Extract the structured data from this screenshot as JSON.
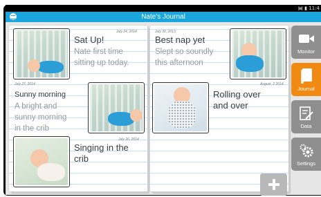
{
  "app": {
    "title": "Nate's Journal",
    "status": {
      "time": "11:4"
    }
  },
  "entries": [
    {
      "date": "July 24, 2014",
      "title": "Sat Up!",
      "text_lines": [
        "Nate first time",
        "sitting up today."
      ]
    },
    {
      "date": "July 27, 2014",
      "title": "Sunny morning",
      "text_lines": [
        "A bright and",
        "sunny morning",
        "in the crib"
      ]
    },
    {
      "date": "July 26, 2014",
      "title_lines": [
        "Singing in the",
        "crib"
      ]
    },
    {
      "date": "July 30, 2013",
      "title": "Best nap yet",
      "text_lines": [
        "Slept so soundly",
        "this afternoon"
      ]
    },
    {
      "date": "August, 2 2014",
      "title_lines": [
        "Rolling over",
        "and over"
      ]
    }
  ],
  "nav": [
    {
      "label": "Monitor",
      "icon": "camera-icon",
      "active": false
    },
    {
      "label": "Journal",
      "icon": "journal-icon",
      "active": true
    },
    {
      "label": "Data",
      "icon": "data-edit-icon",
      "active": false
    },
    {
      "label": "Settings",
      "icon": "gears-icon",
      "active": false
    }
  ],
  "colors": {
    "header": "#19a5dd",
    "active_nav": "#f18a13",
    "nav": "#8f8f8f",
    "line": "#bfe7f3"
  }
}
